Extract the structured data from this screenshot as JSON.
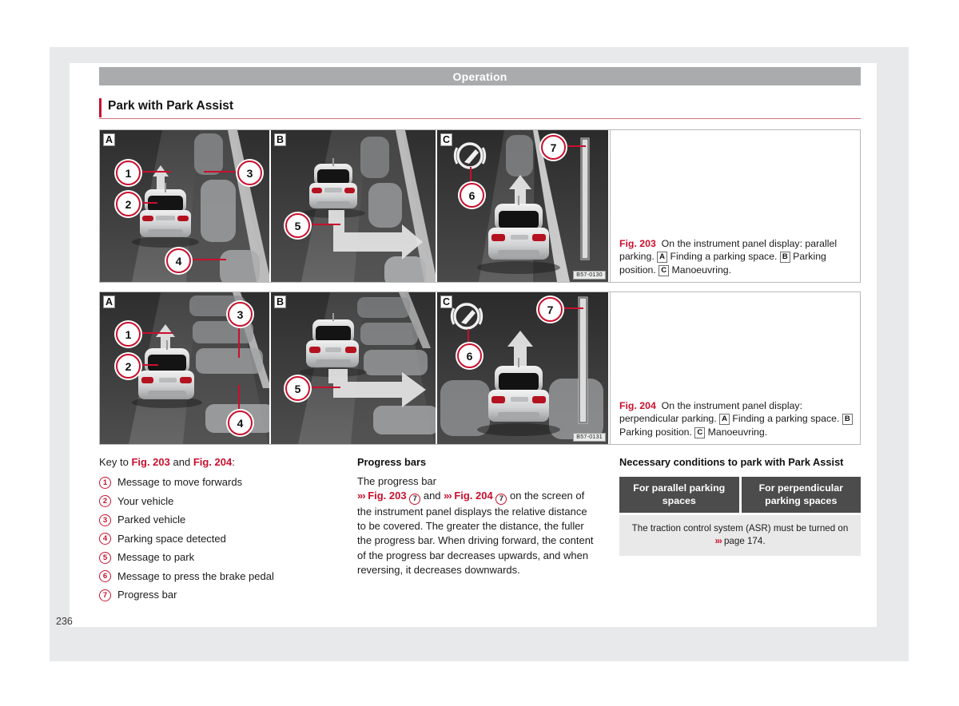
{
  "page": {
    "running_head": "Operation",
    "section_title": "Park with Park Assist",
    "folio": "236"
  },
  "figures": [
    {
      "id": "fig-203",
      "image_code": "B57-0130",
      "panels": [
        {
          "letter": "A",
          "callouts": [
            {
              "n": "1"
            },
            {
              "n": "2"
            },
            {
              "n": "3"
            },
            {
              "n": "4"
            }
          ]
        },
        {
          "letter": "B",
          "callouts": [
            {
              "n": "5"
            }
          ]
        },
        {
          "letter": "C",
          "callouts": [
            {
              "n": "6"
            },
            {
              "n": "7"
            }
          ]
        }
      ],
      "caption": {
        "ref": "Fig. 203",
        "text_1": "On the instrument panel display: parallel parking.",
        "letter_a": "A",
        "text_2": "Finding a parking space.",
        "letter_b": "B",
        "text_3": "Parking position.",
        "letter_c": "C",
        "text_4": "Manoeuvring."
      }
    },
    {
      "id": "fig-204",
      "image_code": "B57-0131",
      "panels": [
        {
          "letter": "A",
          "callouts": [
            {
              "n": "1"
            },
            {
              "n": "2"
            },
            {
              "n": "3"
            },
            {
              "n": "4"
            }
          ]
        },
        {
          "letter": "B",
          "callouts": [
            {
              "n": "5"
            }
          ]
        },
        {
          "letter": "C",
          "callouts": [
            {
              "n": "6"
            },
            {
              "n": "7"
            }
          ]
        }
      ],
      "caption": {
        "ref": "Fig. 204",
        "text_1": "On the instrument panel display: perpendicular parking.",
        "letter_a": "A",
        "text_2": "Finding a parking space.",
        "letter_b": "B",
        "text_3": "Parking position.",
        "letter_c": "C",
        "text_4": "Manoeuvring."
      }
    }
  ],
  "key_column": {
    "intro_prefix": "Key to ",
    "intro_ref_1": "Fig. 203",
    "intro_mid": " and ",
    "intro_ref_2": "Fig. 204",
    "intro_suffix": ":",
    "items": [
      {
        "num": "1",
        "label": "Message to move forwards"
      },
      {
        "num": "2",
        "label": "Your vehicle"
      },
      {
        "num": "3",
        "label": "Parked vehicle"
      },
      {
        "num": "4",
        "label": "Parking space detected"
      },
      {
        "num": "5",
        "label": "Message to park"
      },
      {
        "num": "6",
        "label": "Message to press the brake pedal"
      },
      {
        "num": "7",
        "label": "Progress bar"
      }
    ]
  },
  "progress_column": {
    "title": "Progress bars",
    "lead": "The progress bar",
    "arrow": "»›",
    "ref_1": "Fig. 203",
    "num_1": "7",
    "conj": " and ",
    "ref_2": "Fig. 204",
    "num_2": "7",
    "body": " on the screen of the instrument panel displays the relative distance to be covered. The greater the distance, the fuller the progress bar. When driving forward, the content of the progress bar decreases upwards, and when reversing, it decreases downwards."
  },
  "conditions_column": {
    "title": "Necessary conditions to park with Park Assist",
    "table": {
      "headers": [
        "For parallel parking spaces",
        "For perpendicular parking spaces"
      ],
      "row_text_prefix": "The traction control system (ASR) must be turned on ",
      "row_arrow": "»›",
      "row_link": " page 174."
    }
  },
  "colors": {
    "accent_red": "#c8102e",
    "running_head_bg": "#a9abad",
    "table_header_bg": "#4c4c4c",
    "table_body_bg": "#e9e9e9",
    "paper_surround": "#e8e9ea"
  }
}
